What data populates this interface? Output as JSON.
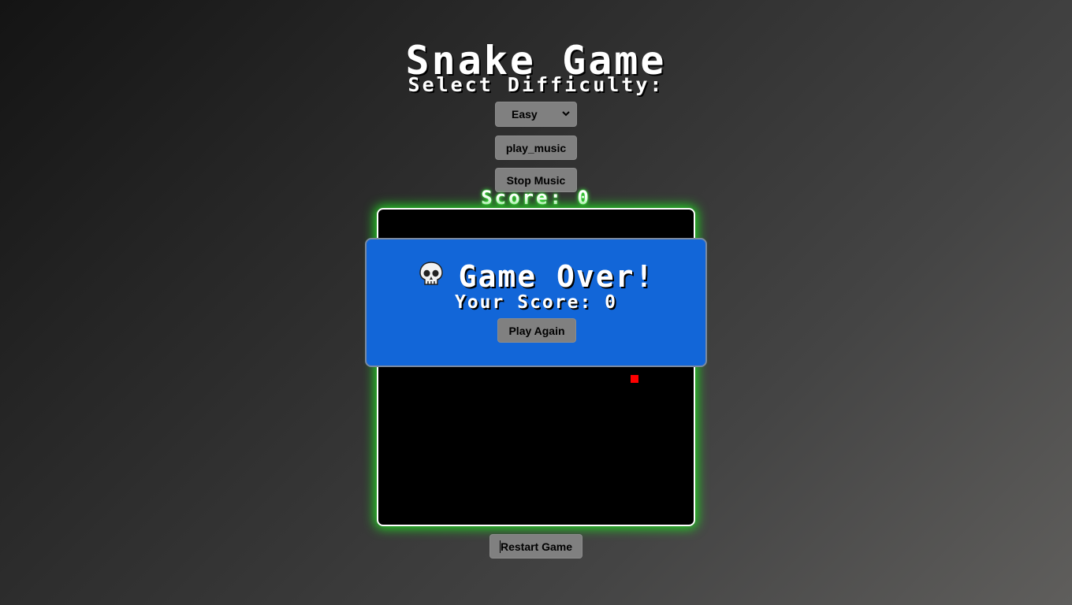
{
  "header": {
    "title": "Snake Game",
    "subtitle": "Select Difficulty:"
  },
  "controls": {
    "difficulty": {
      "selected": "Easy"
    },
    "play_music_label": "play_music",
    "stop_music_label": "Stop Music"
  },
  "score": {
    "label": "Score: 0",
    "value": 0
  },
  "game_over": {
    "heading": "Game Over!",
    "icon": "skull-icon",
    "your_score": "Your Score: 0",
    "play_again_label": "Play Again"
  },
  "board": {
    "food_icon": "food-square",
    "food_color": "#ff0000",
    "glow_color": "#22d622",
    "overlay_color": "#1266d8"
  },
  "footer": {
    "restart_label": "Restart Game"
  }
}
